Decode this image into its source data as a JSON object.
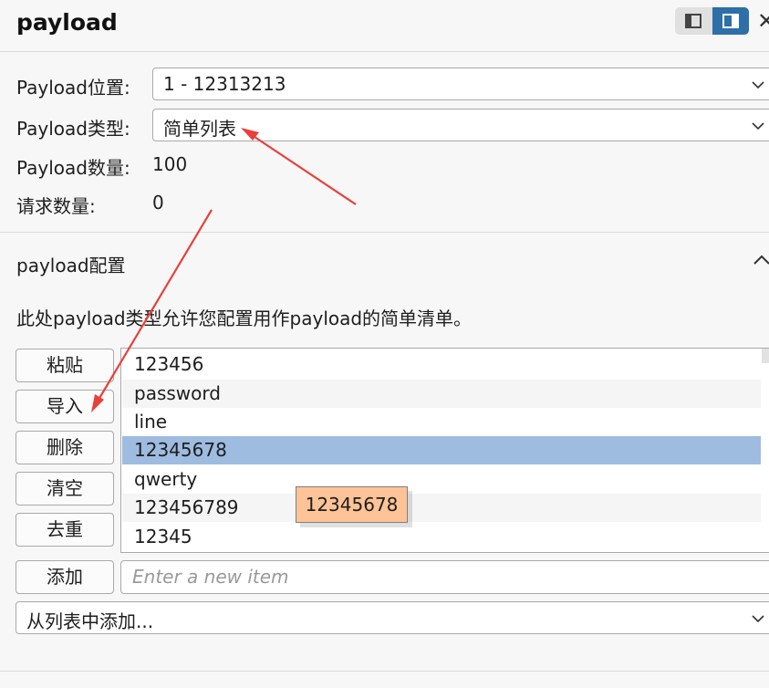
{
  "header": {
    "title": "payload"
  },
  "settings": {
    "position_label": "Payload位置:",
    "position_value": "1 - 12313213",
    "type_label": "Payload类型:",
    "type_value": "简单列表",
    "count_label": "Payload数量:",
    "count_value": "100",
    "request_label": "请求数量:",
    "request_value": "0"
  },
  "config": {
    "title": "payload配置",
    "description": "此处payload类型允许您配置用作payload的简单清单。",
    "buttons": {
      "paste": "粘贴",
      "load": "导入",
      "remove": "删除",
      "clear": "清空",
      "dedupe": "去重",
      "add": "添加"
    },
    "items": [
      "123456",
      "password",
      "line",
      "12345678",
      "qwerty",
      "123456789",
      "12345"
    ],
    "selected_index": 3,
    "tooltip": "12345678",
    "add_placeholder": "Enter a new item",
    "add_from_list": "从列表中添加..."
  },
  "icons": [
    "layout-left-icon",
    "layout-right-icon",
    "close-icon",
    "chevron-down-icon",
    "chevron-up-icon"
  ],
  "colors": {
    "accent": "#2d6fa7",
    "selection": "#9ebbe0",
    "tooltip": "#fec396",
    "annotation": "#e8403a"
  }
}
